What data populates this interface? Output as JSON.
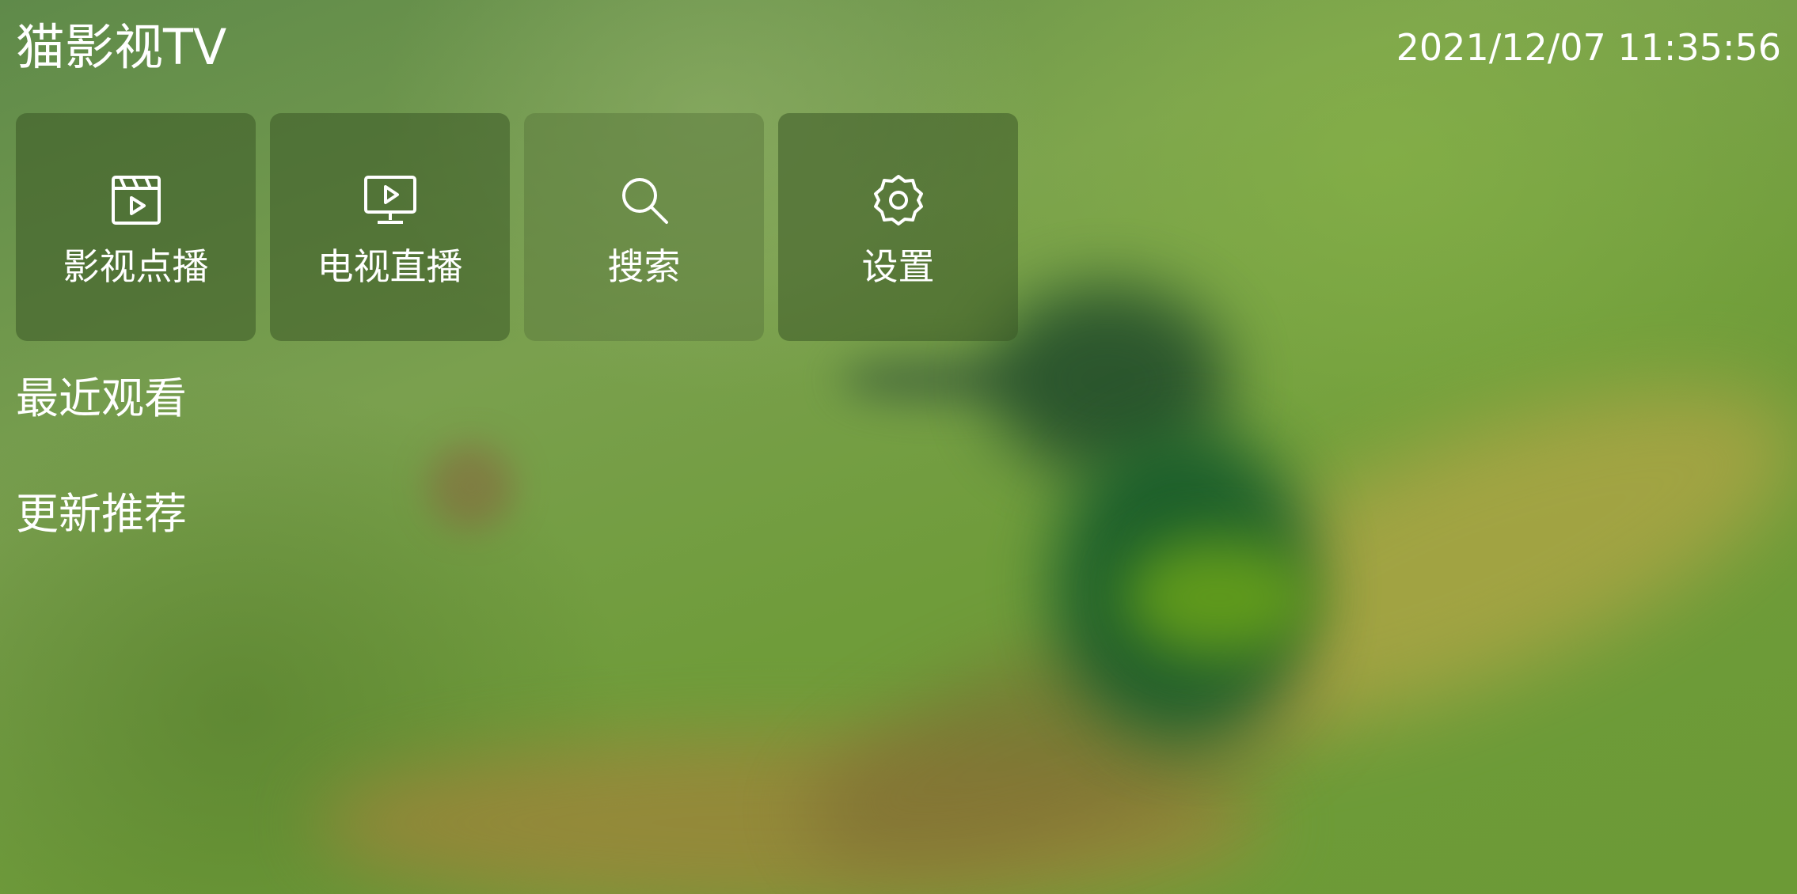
{
  "app": {
    "title": "猫影视TV",
    "datetime": "2021/12/07 11:35:56"
  },
  "menu": {
    "items": [
      {
        "label": "影视点播",
        "icon": "clapperboard-play-icon"
      },
      {
        "label": "电视直播",
        "icon": "monitor-play-icon"
      },
      {
        "label": "搜索",
        "icon": "search-icon"
      },
      {
        "label": "设置",
        "icon": "gear-icon"
      }
    ]
  },
  "sections": {
    "recent": "最近观看",
    "updates": "更新推荐"
  }
}
